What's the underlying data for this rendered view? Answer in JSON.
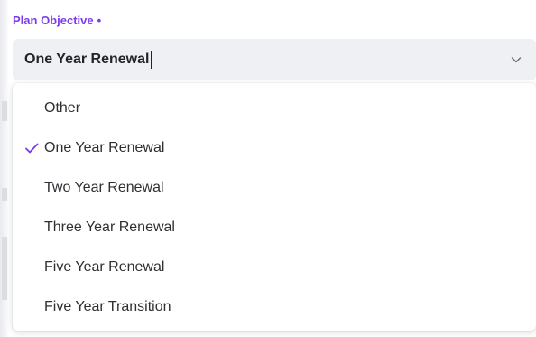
{
  "field": {
    "label": "Plan Objective",
    "required_marker": "•",
    "selected_value": "One Year Renewal"
  },
  "dropdown": {
    "options": [
      {
        "label": "Other",
        "selected": false
      },
      {
        "label": "One Year Renewal",
        "selected": true
      },
      {
        "label": "Two Year Renewal",
        "selected": false
      },
      {
        "label": "Three Year Renewal",
        "selected": false
      },
      {
        "label": "Five Year Renewal",
        "selected": false
      },
      {
        "label": "Five Year Transition",
        "selected": false
      }
    ]
  },
  "icons": {
    "dropdown_toggle": "chevron-down-icon",
    "selected_indicator": "check-icon"
  },
  "colors": {
    "accent": "#7c3aed",
    "select_background": "#eef0f4",
    "text": "#2d2f33"
  }
}
